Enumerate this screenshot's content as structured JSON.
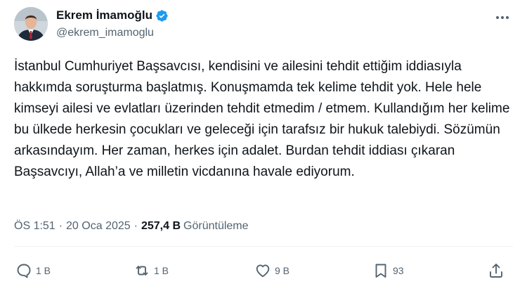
{
  "author": {
    "name": "Ekrem İmamoğlu",
    "handle": "@ekrem_imamoglu",
    "verified_color": "#1d9bf0"
  },
  "post": {
    "text": "İstanbul Cumhuriyet Başsavcısı, kendisini ve ailesini tehdit ettiğim iddiasıyla hakkımda soruşturma başlatmış. Konuşmamda tek kelime tehdit yok. Hele hele kimseyi ailesi ve evlatları üzerinden tehdit etmedim / etmem. Kullandığım her kelime bu ülkede herkesin çocukları ve geleceği için tarafsız bir hukuk talebiydi. Sözümün arkasındayım. Her zaman, herkes için adalet. Burdan tehdit iddiası çıkaran Başsavcıyı, Allah’a ve milletin vicdanına havale ediyorum.",
    "time": "ÖS 1:51",
    "separator": "·",
    "date": "20 Oca 2025",
    "views_count": "257,4 B",
    "views_label": "Görüntüleme"
  },
  "actions": {
    "replies": "1 B",
    "reposts": "1 B",
    "likes": "9 B",
    "bookmarks": "93"
  },
  "icons": [
    "avatar",
    "verified-icon",
    "more-icon",
    "reply-icon",
    "repost-icon",
    "like-icon",
    "bookmark-icon",
    "share-icon"
  ]
}
